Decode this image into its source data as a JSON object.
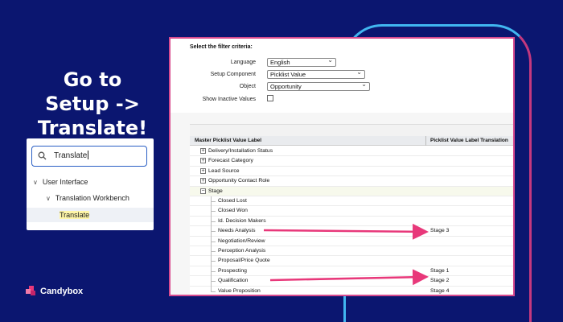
{
  "headline": [
    "Go to",
    "Setup ->",
    "Translate!"
  ],
  "sidebar": {
    "search_value": "Translate",
    "items": [
      {
        "label": "User Interface"
      },
      {
        "label": "Translation Workbench"
      },
      {
        "label": "Translate"
      }
    ]
  },
  "brand": {
    "name": "Candybox"
  },
  "filters": {
    "title": "Select the filter criteria:",
    "language_label": "Language",
    "language_value": "English",
    "setup_component_label": "Setup Component",
    "setup_component_value": "Picklist Value",
    "object_label": "Object",
    "object_value": "Opportunity",
    "show_inactive_label": "Show Inactive Values"
  },
  "table": {
    "col_master": "Master Picklist Value Label",
    "col_translation": "Picklist Value Label Translation",
    "groups": [
      {
        "label": "Delivery/Installation Status"
      },
      {
        "label": "Forecast Category"
      },
      {
        "label": "Lead Source"
      },
      {
        "label": "Opportunity Contact Role"
      },
      {
        "label": "Stage"
      }
    ],
    "stage_values": [
      {
        "label": "Closed Lost",
        "translation": ""
      },
      {
        "label": "Closed Won",
        "translation": ""
      },
      {
        "label": "Id. Decision Makers",
        "translation": ""
      },
      {
        "label": "Needs Analysis",
        "translation": "Stage 3"
      },
      {
        "label": "Negotiation/Review",
        "translation": ""
      },
      {
        "label": "Perception Analysis",
        "translation": ""
      },
      {
        "label": "Proposal/Price Quote",
        "translation": ""
      },
      {
        "label": "Prospecting",
        "translation": "Stage 1"
      },
      {
        "label": "Qualification",
        "translation": "Stage 2"
      },
      {
        "label": "Value Proposition",
        "translation": "Stage 4"
      }
    ]
  },
  "colors": {
    "background": "#0b1670",
    "accent_pink": "#e8387a",
    "accent_blue": "#41b6f0"
  }
}
